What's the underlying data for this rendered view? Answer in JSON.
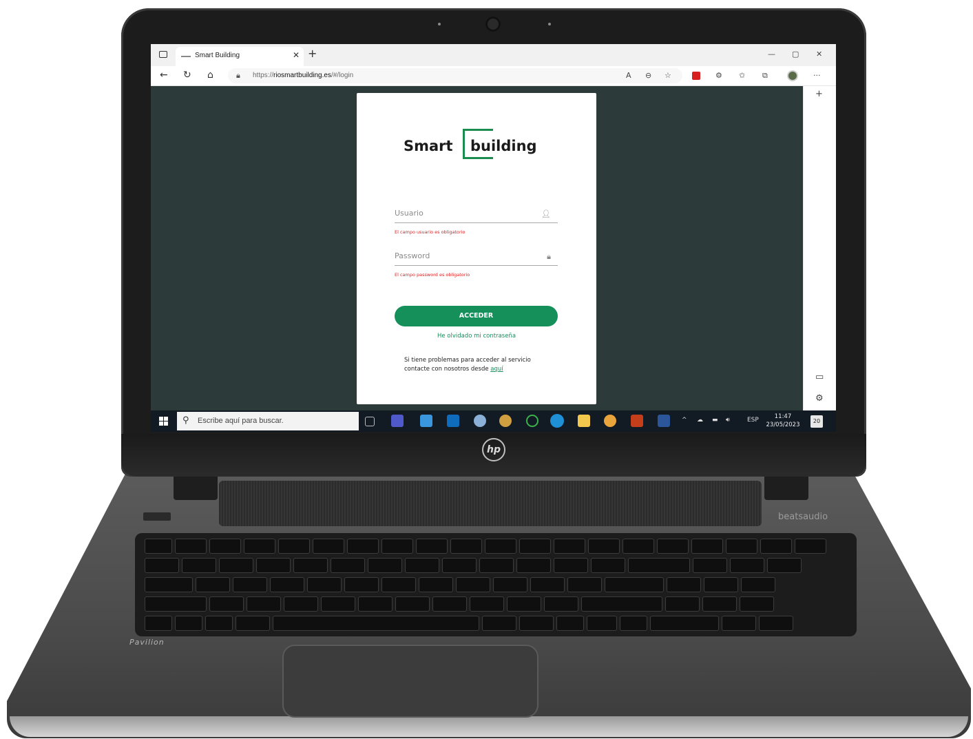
{
  "browser": {
    "tab_title": "Smart Building",
    "url_prefix": "https://",
    "url_domain": "riosmartbuilding.es",
    "url_path": "/#/login"
  },
  "login": {
    "logo_left": "Smart",
    "logo_right": "building",
    "username_placeholder": "Usuario",
    "username_error": "El campo usuario es obligatorio",
    "password_placeholder": "Password",
    "password_error": "El campo password es obligatorio",
    "submit_label": "ACCEDER",
    "forgot_label": "He olvidado mi contraseña",
    "help_text": "Si tiene problemas para acceder al servicio contacte con nosotros desde ",
    "help_link": "aquí"
  },
  "taskbar": {
    "search_placeholder": "Escribe aquí para buscar.",
    "language": "ESP",
    "time": "11:47",
    "date": "23/05/2023",
    "notifications": "20"
  },
  "laptop": {
    "model": "Pavilion",
    "audio_brand": "beatsaudio",
    "brand_logo": "hp"
  },
  "colors": {
    "accent_green": "#15905a",
    "error_red": "#e01c1c",
    "page_background": "#2d3a3a"
  }
}
